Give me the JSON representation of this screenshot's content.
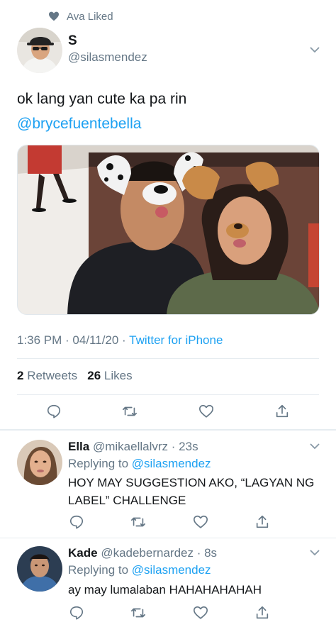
{
  "social_context": {
    "text": "Ava Liked",
    "icon": "heart-icon"
  },
  "tweet": {
    "author_name": "S",
    "author_handle": "@silasmendez",
    "text": "ok lang yan cute ka pa rin",
    "mention": "@brycefuentebella",
    "timestamp": "1:36 PM · 04/11/20 · ",
    "source": "Twitter for iPhone",
    "retweet_count": "2",
    "retweet_label": "Retweets",
    "like_count": "26",
    "like_label": "Likes"
  },
  "replies": [
    {
      "name": "Ella",
      "handle": "@mikaellalvrz",
      "time": "· 23s",
      "replying_label": "Replying to",
      "replying_to": "@silasmendez",
      "text": "HOY MAY SUGGESTION AKO, “LAGYAN NG LABEL” CHALLENGE"
    },
    {
      "name": "Kade",
      "handle": "@kadebernardez",
      "time": "· 8s",
      "replying_label": "Replying to",
      "replying_to": "@silasmendez",
      "text": "ay may lumalaban HAHAHAHAHAH"
    }
  ],
  "actions": [
    "reply-icon",
    "retweet-icon",
    "like-icon",
    "share-icon"
  ],
  "colors": {
    "accent": "#1da1f2",
    "muted": "#657786",
    "text": "#14171a",
    "divider": "#e6ecf0"
  }
}
